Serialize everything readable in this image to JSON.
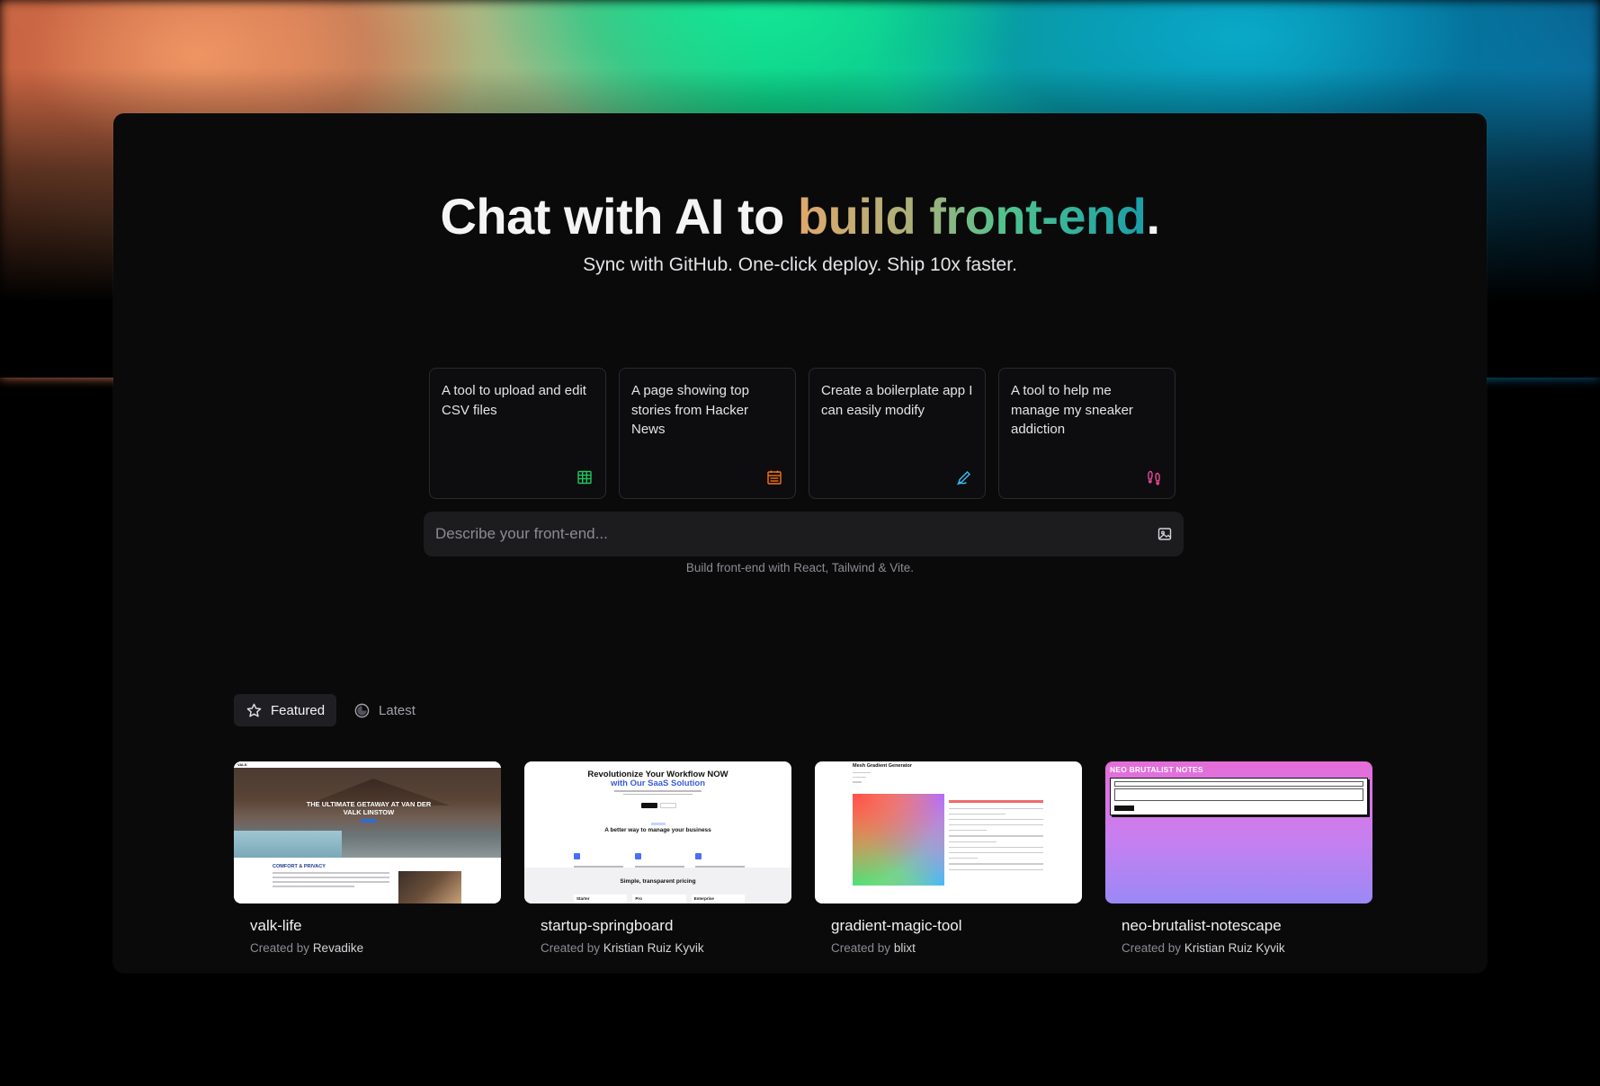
{
  "hero": {
    "title_plain": "Chat with AI to ",
    "title_gradient": "build front-end",
    "title_end": ".",
    "subtitle": "Sync with GitHub. One-click deploy. Ship 10x faster."
  },
  "suggestions": [
    {
      "text": "A tool to upload and edit CSV files",
      "icon": "table-icon",
      "icon_color": "#22c55e"
    },
    {
      "text": "A page showing top stories from Hacker News",
      "icon": "calendar-icon",
      "icon_color": "#f97316"
    },
    {
      "text": "Create a boilerplate app I can easily modify",
      "icon": "pencil-icon",
      "icon_color": "#38bdf8"
    },
    {
      "text": "A tool to help me manage my sneaker addiction",
      "icon": "footprints-icon",
      "icon_color": "#ec4899"
    }
  ],
  "prompt": {
    "placeholder": "Describe your front-end...",
    "hint": "Build front-end with React, Tailwind & Vite."
  },
  "tabs": [
    {
      "label": "Featured",
      "icon": "star-icon",
      "active": true
    },
    {
      "label": "Latest",
      "icon": "clock-icon",
      "active": false
    }
  ],
  "projects_by_label": "Created by",
  "projects": [
    {
      "name": "valk-life",
      "author": "Revadike",
      "thumb": {
        "brand": "VALK",
        "headline": "THE ULTIMATE GETAWAY AT VAN DER VALK LINSTOW",
        "section": "COMFORT & PRIVACY"
      }
    },
    {
      "name": "startup-springboard",
      "author": "Kristian Ruiz Kyvik",
      "thumb": {
        "headline1": "Revolutionize Your Workflow NOW",
        "headline2": "with Our SaaS Solution",
        "section": "A better way to manage your business",
        "pricing": "Simple, transparent pricing",
        "plans": [
          "Starter",
          "Pro",
          "Enterprise"
        ]
      }
    },
    {
      "name": "gradient-magic-tool",
      "author": "blixt",
      "thumb": {
        "title": "Mesh Gradient Generator"
      }
    },
    {
      "name": "neo-brutalist-notescape",
      "author": "Kristian Ruiz Kyvik",
      "thumb": {
        "title": "NEO BRUTALIST NOTES"
      }
    }
  ],
  "colors": {
    "panel_bg": "#0a0a0b",
    "accent_gradient": [
      "#e0a86b",
      "#4fc38e",
      "#1a9ea8"
    ]
  }
}
